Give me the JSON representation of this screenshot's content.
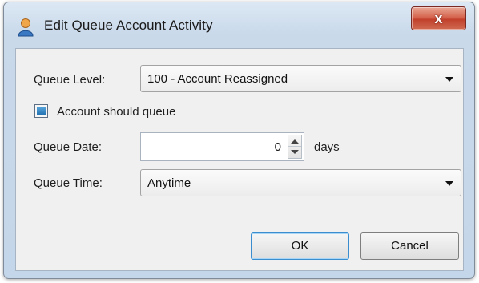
{
  "window": {
    "title": "Edit Queue Account Activity",
    "icon": "user-icon",
    "close_label": "x"
  },
  "form": {
    "queue_level_label": "Queue Level:",
    "queue_level_value": "100 - Account Reassigned",
    "account_queue_label": "Account should queue",
    "account_queue_checked": true,
    "queue_date_label": "Queue Date:",
    "queue_date_value": "0",
    "queue_date_unit": "days",
    "queue_time_label": "Queue Time:",
    "queue_time_value": "Anytime"
  },
  "buttons": {
    "ok": "OK",
    "cancel": "Cancel"
  },
  "colors": {
    "title_gradient_top": "#dce8f4",
    "close_red": "#c1412c",
    "checkbox_blue": "#1f6fb0",
    "default_button_border": "#3a8ed0"
  }
}
